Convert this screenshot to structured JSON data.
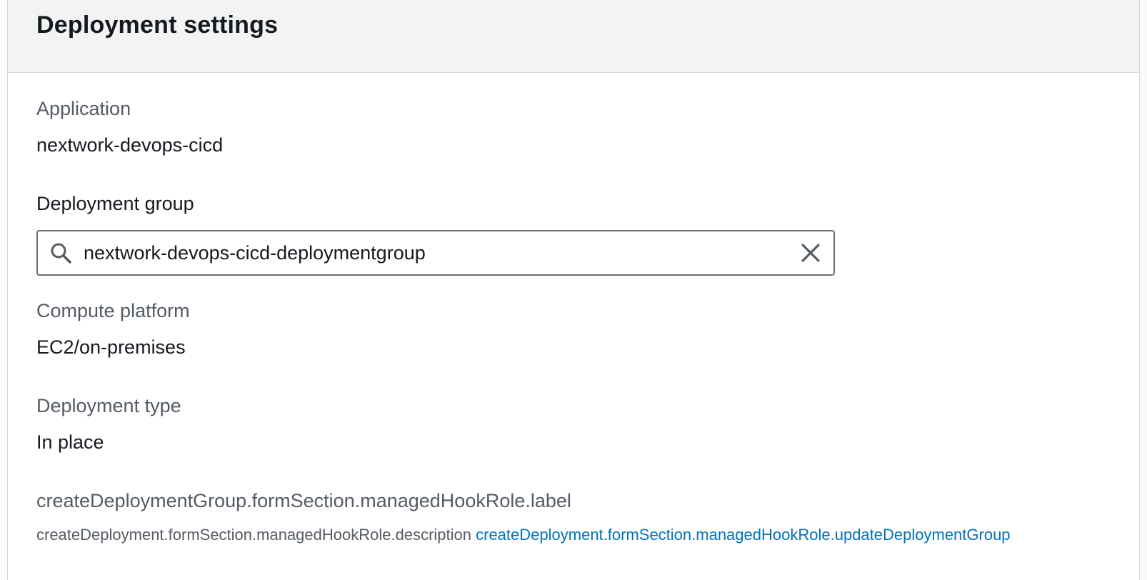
{
  "header": {
    "title": "Deployment settings"
  },
  "application": {
    "label": "Application",
    "value": "nextwork-devops-cicd"
  },
  "deployment_group": {
    "label": "Deployment group",
    "value": "nextwork-devops-cicd-deploymentgroup",
    "icons": {
      "search": "search-icon",
      "clear": "close-icon"
    }
  },
  "compute_platform": {
    "label": "Compute platform",
    "value": "EC2/on-premises"
  },
  "deployment_type": {
    "label": "Deployment type",
    "value": "In place"
  },
  "managed_hook_role": {
    "label": "createDeploymentGroup.formSection.managedHookRole.label",
    "description": "createDeployment.formSection.managedHookRole.description",
    "link": "createDeployment.formSection.managedHookRole.updateDeploymentGroup"
  },
  "colors": {
    "link": "#0073bb",
    "muted_text": "#545b64",
    "text": "#16191f",
    "header_bg": "#f2f3f3"
  }
}
